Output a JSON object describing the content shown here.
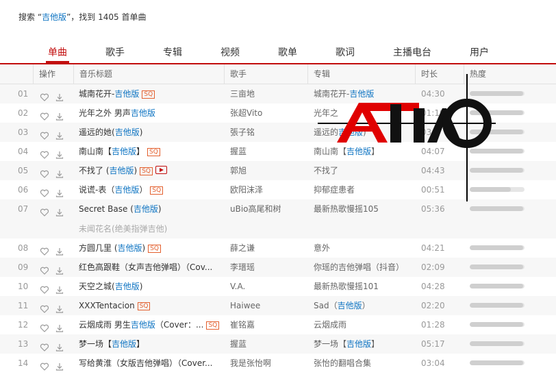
{
  "summary": {
    "prefix": "搜索 “",
    "keyword": "吉他版",
    "suffix": "”，找到 1405 首单曲"
  },
  "tabs": [
    "单曲",
    "歌手",
    "专辑",
    "视频",
    "歌单",
    "歌词",
    "主播电台",
    "用户"
  ],
  "columns": [
    "操作",
    "音乐标题",
    "歌手",
    "专辑",
    "时长",
    "热度"
  ],
  "watermark": "ATIAO",
  "songs": [
    {
      "num": "01",
      "title": [
        {
          "t": "城南花开-"
        },
        {
          "t": "吉他版",
          "h": true
        }
      ],
      "badges": [
        "SQ"
      ],
      "artist": "三亩地",
      "album": [
        {
          "t": "城南花开-"
        },
        {
          "t": "吉他版",
          "h": true
        }
      ],
      "duration": "04:30",
      "heat": 0.98
    },
    {
      "num": "02",
      "title": [
        {
          "t": "光年之外 男声"
        },
        {
          "t": "吉他版",
          "h": true
        }
      ],
      "badges": [],
      "artist": "张超Vito",
      "album": [
        {
          "t": "光年之"
        }
      ],
      "duration": "01:19",
      "heat": 0.98
    },
    {
      "num": "03",
      "title": [
        {
          "t": "遥远的她("
        },
        {
          "t": "吉他版",
          "h": true
        },
        {
          "t": ")"
        }
      ],
      "badges": [],
      "artist": "張子铭",
      "album": [
        {
          "t": "遥远的"
        },
        {
          "t": "吉他版",
          "h": true
        },
        {
          "t": ")"
        }
      ],
      "duration": "03:2",
      "heat": 0.98
    },
    {
      "num": "04",
      "title": [
        {
          "t": "南山南【"
        },
        {
          "t": "吉他版",
          "h": true
        },
        {
          "t": "】"
        }
      ],
      "badges": [
        "SQ"
      ],
      "artist": "握蓝",
      "album": [
        {
          "t": "南山南【"
        },
        {
          "t": "吉他版",
          "h": true
        },
        {
          "t": "】"
        }
      ],
      "duration": "04:07",
      "heat": 0.98
    },
    {
      "num": "05",
      "title": [
        {
          "t": "不找了 ("
        },
        {
          "t": "吉他版",
          "h": true
        },
        {
          "t": ")"
        }
      ],
      "badges": [
        "SQ",
        "MV"
      ],
      "artist": "郭旭",
      "album": [
        {
          "t": "不找了"
        }
      ],
      "duration": "04:43",
      "heat": 0.98
    },
    {
      "num": "06",
      "title": [
        {
          "t": "说谎-表（"
        },
        {
          "t": "吉他版",
          "h": true
        },
        {
          "t": "）"
        }
      ],
      "badges": [
        "SQ"
      ],
      "artist": "欧阳沫泽",
      "album": [
        {
          "t": "抑郁症患者"
        }
      ],
      "duration": "00:51",
      "heat": 0.75
    },
    {
      "num": "07",
      "title": [
        {
          "t": "Secret Base ("
        },
        {
          "t": "吉他版",
          "h": true
        },
        {
          "t": ")"
        }
      ],
      "badges": [],
      "artist": "uBio高尾和树",
      "album": [
        {
          "t": "最新热歌慢摇105"
        }
      ],
      "duration": "05:36",
      "heat": 0.98,
      "subtitle": "未闻花名(绝美指弹吉他)"
    },
    {
      "num": "08",
      "title": [
        {
          "t": "方圆几里 ("
        },
        {
          "t": "吉他版",
          "h": true
        },
        {
          "t": ")"
        }
      ],
      "badges": [
        "SQ"
      ],
      "artist": "薛之谦",
      "album": [
        {
          "t": "意外"
        }
      ],
      "duration": "04:21",
      "heat": 0.98
    },
    {
      "num": "09",
      "title": [
        {
          "t": "红色高跟鞋（女声吉他弹唱）（Cov..."
        }
      ],
      "badges": [],
      "artist": "李瑨瑶",
      "album": [
        {
          "t": "你瑶的吉他弹唱（抖音）"
        }
      ],
      "duration": "02:09",
      "heat": 0.98
    },
    {
      "num": "10",
      "title": [
        {
          "t": "天空之城("
        },
        {
          "t": "吉他版",
          "h": true
        },
        {
          "t": ")"
        }
      ],
      "badges": [],
      "artist": "V.A.",
      "album": [
        {
          "t": "最新热歌慢摇101"
        }
      ],
      "duration": "04:28",
      "heat": 0.98
    },
    {
      "num": "11",
      "title": [
        {
          "t": "XXXTentacion"
        }
      ],
      "badges": [
        "SQ"
      ],
      "artist": "Haiwee",
      "album": [
        {
          "t": "Sad（"
        },
        {
          "t": "吉他版",
          "h": true
        },
        {
          "t": "）"
        }
      ],
      "duration": "02:20",
      "heat": 0.98
    },
    {
      "num": "12",
      "title": [
        {
          "t": "云烟成雨 男生"
        },
        {
          "t": "吉他版",
          "h": true
        },
        {
          "t": "（Cover：..."
        }
      ],
      "badges": [
        "SQ"
      ],
      "artist": "崔铭嘉",
      "album": [
        {
          "t": "云烟成雨"
        }
      ],
      "duration": "01:28",
      "heat": 0.98
    },
    {
      "num": "13",
      "title": [
        {
          "t": "梦一场【"
        },
        {
          "t": "吉他版",
          "h": true
        },
        {
          "t": "】"
        }
      ],
      "badges": [],
      "artist": "握蓝",
      "album": [
        {
          "t": "梦一场【"
        },
        {
          "t": "吉他版",
          "h": true
        },
        {
          "t": "】"
        }
      ],
      "duration": "05:17",
      "heat": 0.98
    },
    {
      "num": "14",
      "title": [
        {
          "t": "写给黄淮（女版吉他弹唱）（Cover..."
        }
      ],
      "badges": [],
      "artist": "我是张怡啊",
      "album": [
        {
          "t": "张怡的翻唱合集"
        }
      ],
      "duration": "03:04",
      "heat": 0.98
    }
  ]
}
